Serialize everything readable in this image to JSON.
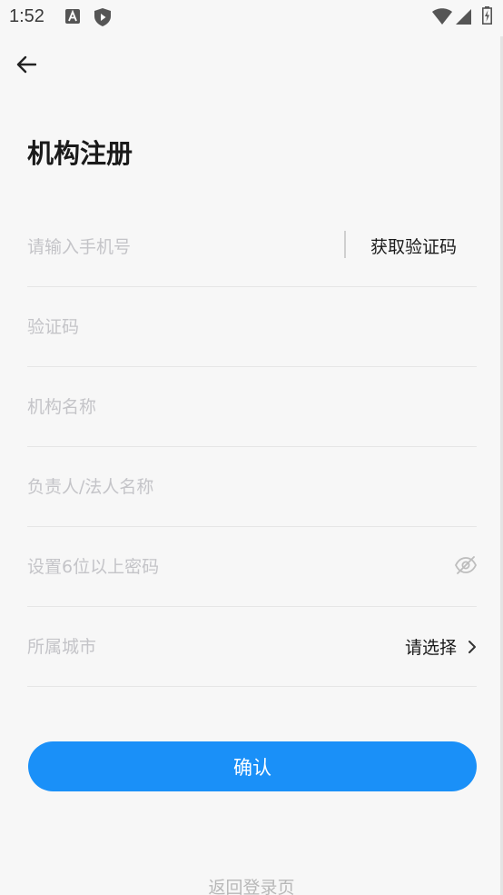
{
  "status_bar": {
    "time": "1:52",
    "icons": [
      "a-notification-icon",
      "shield-play-icon",
      "wifi-icon",
      "signal-icon",
      "battery-icon"
    ]
  },
  "header": {
    "back_icon": "arrow-left-icon",
    "title": "机构注册"
  },
  "form": {
    "phone": {
      "placeholder": "请输入手机号",
      "get_code_label": "获取验证码"
    },
    "code": {
      "placeholder": "验证码"
    },
    "org_name": {
      "placeholder": "机构名称"
    },
    "legal_person": {
      "placeholder": "负责人/法人名称"
    },
    "password": {
      "placeholder": "设置6位以上密码",
      "toggle_icon": "eye-off-icon"
    },
    "city": {
      "label": "所属城市",
      "value": "请选择",
      "chevron_icon": "chevron-right-icon"
    }
  },
  "actions": {
    "confirm_label": "确认",
    "back_login_label": "返回登录页"
  },
  "colors": {
    "primary": "#1a90f8",
    "background": "#f7f7f7",
    "placeholder": "#c4c4c8",
    "divider": "#e6e6e6"
  }
}
